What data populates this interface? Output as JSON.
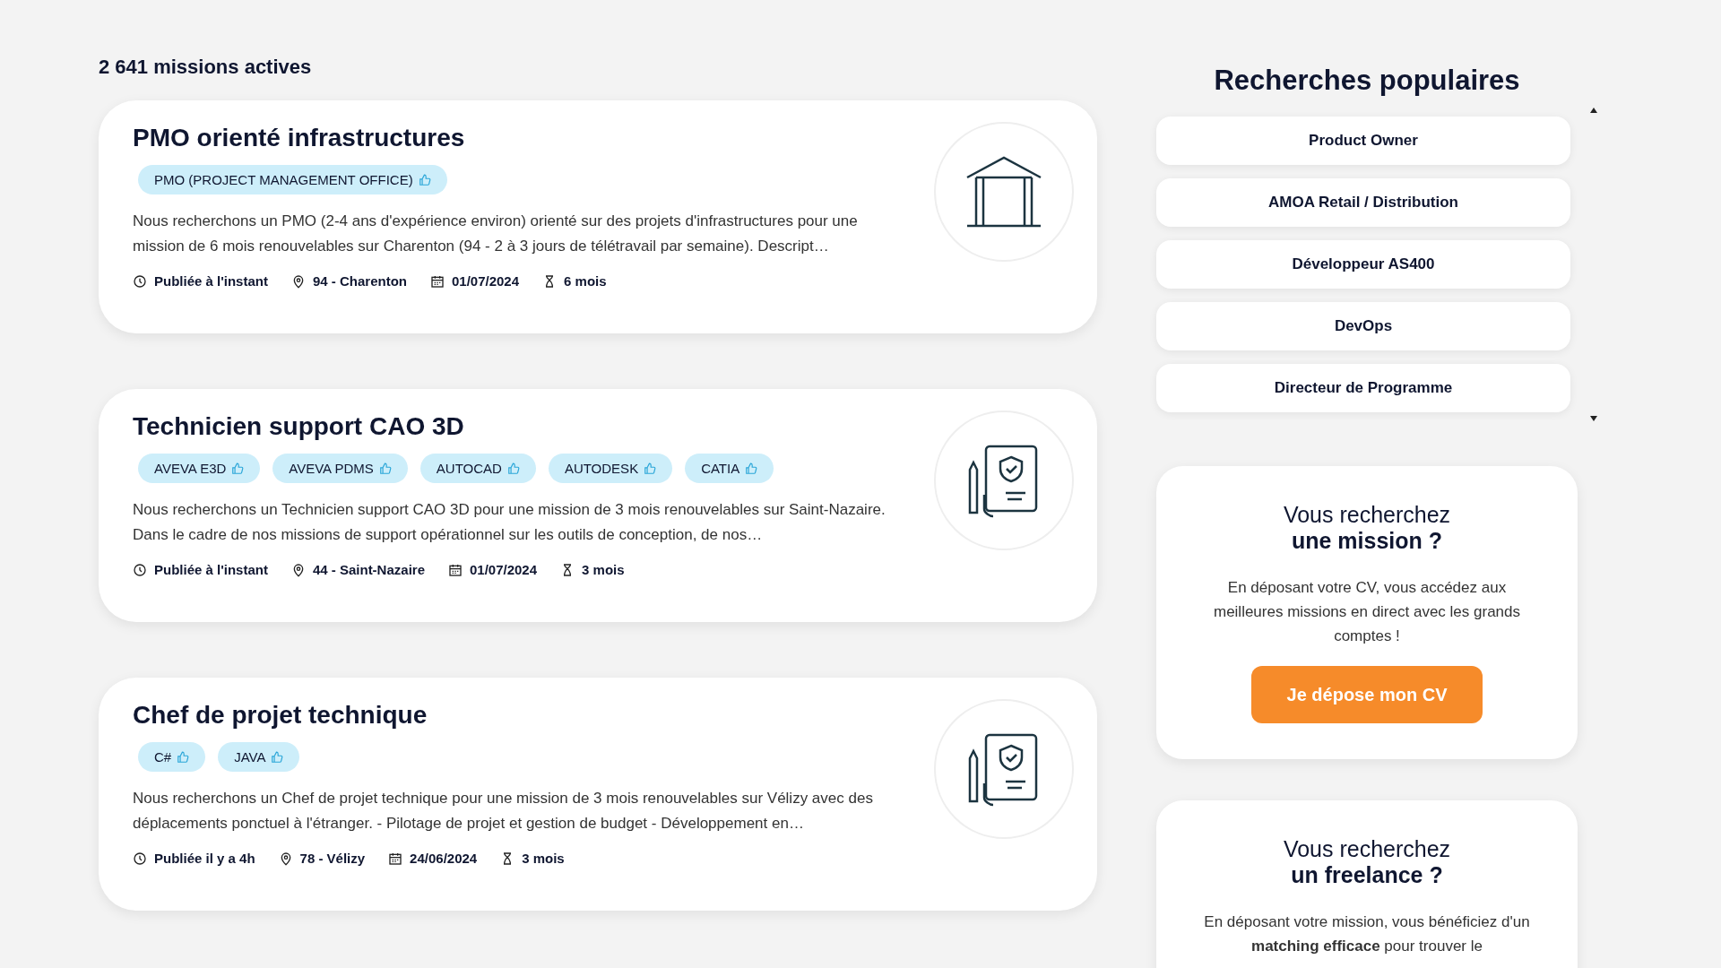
{
  "results_count": "2 641 missions actives",
  "missions": [
    {
      "title": "PMO orienté infrastructures",
      "tags": [
        "PMO (PROJECT MANAGEMENT OFFICE)"
      ],
      "description": "Nous recherchons un PMO (2-4 ans d'expérience environ) orienté sur des projets d'infrastructures pour une mission de 6 mois renouvelables sur Charenton (94 - 2 à 3 jours de télétravail par semaine). Descript…",
      "published": "Publiée à l'instant",
      "location": "94 - Charenton",
      "date": "01/07/2024",
      "duration": "6 mois",
      "kind": "building"
    },
    {
      "title": "Technicien support CAO 3D",
      "tags": [
        "AVEVA E3D",
        "AVEVA PDMS",
        "AUTOCAD",
        "AUTODESK",
        "CATIA"
      ],
      "description": "Nous recherchons un Technicien support CAO 3D pour une mission de 3 mois renouvelables sur Saint-Nazaire. Dans le cadre de nos missions de support opérationnel sur les outils de conception, de nos…",
      "published": "Publiée à l'instant",
      "location": "44 - Saint-Nazaire",
      "date": "01/07/2024",
      "duration": "3 mois",
      "kind": "document"
    },
    {
      "title": "Chef de projet technique",
      "tags": [
        "C#",
        "JAVA"
      ],
      "description": "Nous recherchons un Chef de projet technique pour une mission de 3 mois renouvelables sur Vélizy avec des déplacements ponctuel à l'étranger.  - Pilotage de projet et gestion de budget  - Développement en…",
      "published": "Publiée il y a 4h",
      "location": "78 - Vélizy",
      "date": "24/06/2024",
      "duration": "3 mois",
      "kind": "document"
    }
  ],
  "popular": {
    "title": "Recherches populaires",
    "items": [
      "Product Owner",
      "AMOA Retail / Distribution",
      "Développeur AS400",
      "DevOps",
      "Directeur de Programme"
    ]
  },
  "promos": [
    {
      "line1": "Vous recherchez",
      "line2": "une mission ?",
      "text": "En déposant votre CV, vous accédez aux meilleures missions en direct avec les grands comptes !",
      "button": "Je dépose mon CV"
    },
    {
      "line1": "Vous recherchez",
      "line2": "un freelance ?",
      "text": "En déposant votre mission, vous bénéficiez d'un **matching efficace** pour trouver le"
    }
  ]
}
